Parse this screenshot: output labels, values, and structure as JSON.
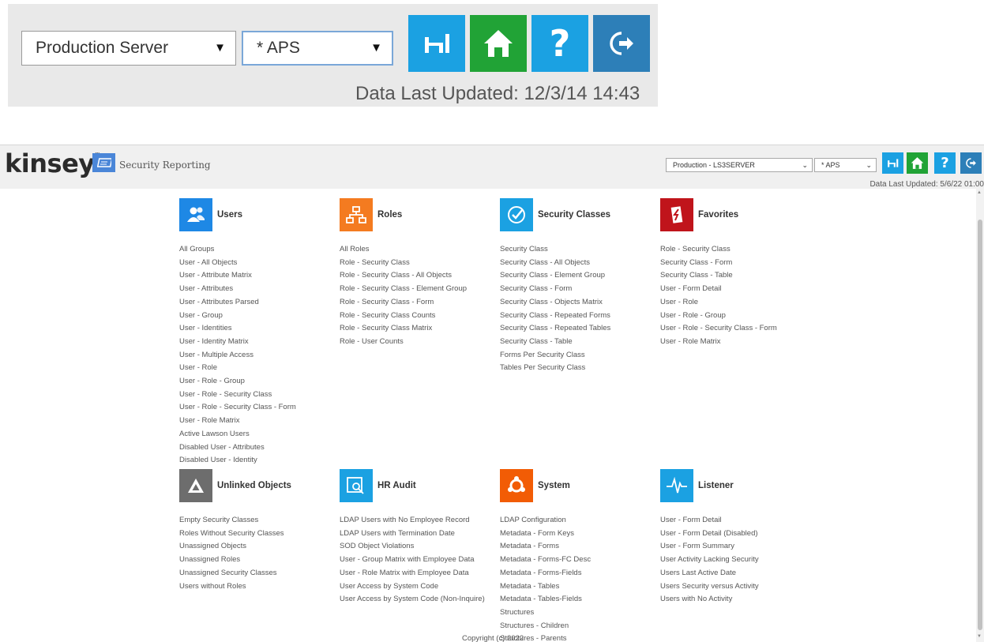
{
  "zoom_toolbar": {
    "server_select": "Production Server",
    "company_select": "* APS",
    "data_last_updated": "Data Last Updated: 12/3/14 14:43",
    "buttons": [
      {
        "icon": "desk-icon",
        "color": "#1ba1e2"
      },
      {
        "icon": "home-icon",
        "color": "#21a336"
      },
      {
        "icon": "help-icon",
        "color": "#1ba1e2"
      },
      {
        "icon": "logout-icon",
        "color": "#2d7fb8"
      }
    ]
  },
  "header": {
    "logo": "kinsey",
    "app_title": "Security Reporting",
    "server_select": "Production - LS3SERVER",
    "company_select": "* APS",
    "data_last_updated": "Data Last Updated: 5/6/22 01:00"
  },
  "sections": [
    {
      "title": "Users",
      "icon": "users-icon",
      "color": "#1e88e5",
      "links": [
        "All Groups",
        "User - All Objects",
        "User - Attribute Matrix",
        "User - Attributes",
        "User - Attributes Parsed",
        "User - Group",
        "User - Identities",
        "User - Identity Matrix",
        "User - Multiple Access",
        "User - Role",
        "User - Role - Group",
        "User - Role - Security Class",
        "User - Role - Security Class - Form",
        "User - Role Matrix",
        "Active Lawson Users",
        "Disabled User - Attributes",
        "Disabled User - Identity"
      ]
    },
    {
      "title": "Roles",
      "icon": "hierarchy-icon",
      "color": "#f47b20",
      "links": [
        "All Roles",
        "Role - Security Class",
        "Role - Security Class - All Objects",
        "Role - Security Class - Element Group",
        "Role - Security Class - Form",
        "Role - Security Class Counts",
        "Role - Security Class Matrix",
        "Role - User Counts"
      ]
    },
    {
      "title": "Security Classes",
      "icon": "checkmark-icon",
      "color": "#1ba1e2",
      "links": [
        "Security Class",
        "Security Class - All Objects",
        "Security Class - Element Group",
        "Security Class - Form",
        "Security Class - Objects Matrix",
        "Security Class - Repeated Forms",
        "Security Class - Repeated Tables",
        "Security Class - Table",
        "Forms Per Security Class",
        "Tables Per Security Class"
      ]
    },
    {
      "title": "Favorites",
      "icon": "favorites-icon",
      "color": "#c0141b",
      "links": [
        "Role - Security Class",
        "Security Class - Form",
        "Security Class - Table",
        "User - Form Detail",
        "User - Role",
        "User - Role - Group",
        "User - Role - Security Class - Form",
        "User - Role Matrix"
      ]
    },
    {
      "title": "Unlinked Objects",
      "icon": "warning-icon",
      "color": "#6d6d6d",
      "links": [
        "Empty Security Classes",
        "Roles Without Security Classes",
        "Unassigned Objects",
        "Unassigned Roles",
        "Unassigned Security Classes",
        "Users without Roles"
      ]
    },
    {
      "title": "HR Audit",
      "icon": "audit-icon",
      "color": "#1ba1e2",
      "links": [
        "LDAP Users with No Employee Record",
        "LDAP Users with Termination Date",
        "SOD Object Violations",
        "User - Group Matrix with Employee Data",
        "User - Role Matrix with Employee Data",
        "User Access by System Code",
        "User Access by System Code (Non-Inquire)"
      ]
    },
    {
      "title": "System",
      "icon": "system-icon",
      "color": "#f25c05",
      "links": [
        "LDAP Configuration",
        "Metadata - Form Keys",
        "Metadata - Forms",
        "Metadata - Forms-FC Desc",
        "Metadata - Forms-Fields",
        "Metadata - Tables",
        "Metadata - Tables-Fields",
        "Structures",
        "Structures - Children",
        "Structures - Parents"
      ]
    },
    {
      "title": "Listener",
      "icon": "pulse-icon",
      "color": "#1ba1e2",
      "links": [
        "User - Form Detail",
        "User - Form Detail (Disabled)",
        "User - Form Summary",
        "User Activity Lacking Security",
        "Users Last Active Date",
        "Users Security versus Activity",
        "Users with No Activity"
      ]
    }
  ],
  "footer": {
    "copyright": "Copyright (c) 2022"
  }
}
